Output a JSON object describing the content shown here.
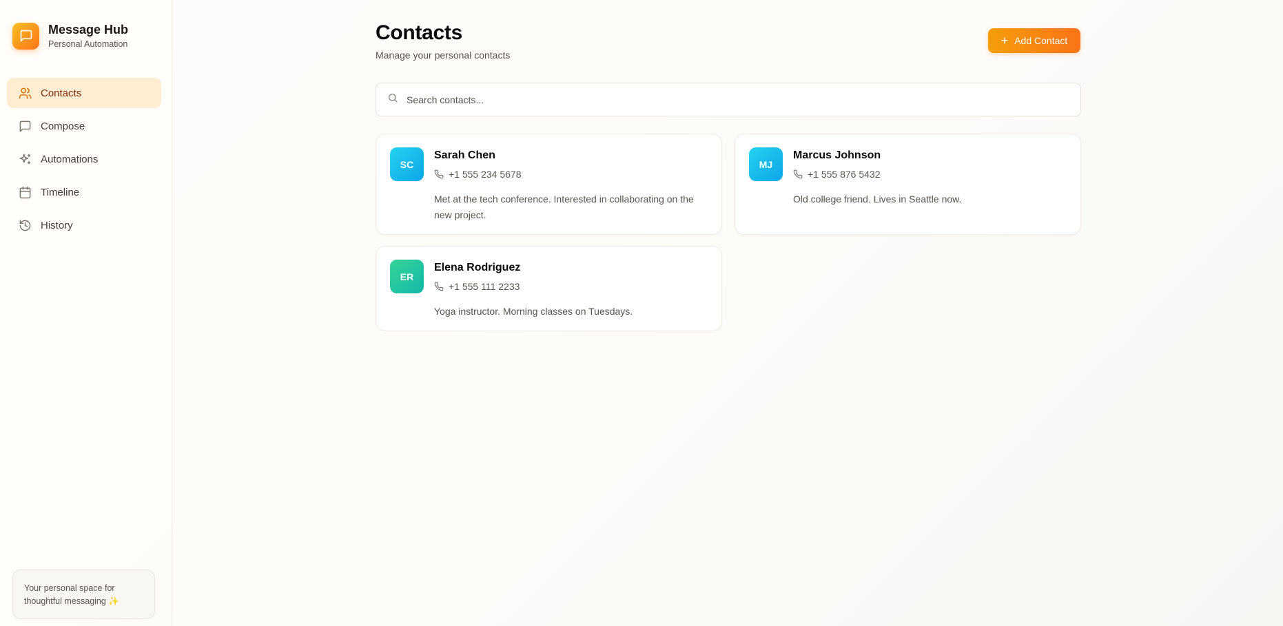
{
  "brand": {
    "title": "Message Hub",
    "subtitle": "Personal Automation",
    "icon": "message-square-icon",
    "gradient": [
      "#fbbf24",
      "#f97316"
    ]
  },
  "nav": {
    "items": [
      {
        "label": "Contacts",
        "icon": "users-icon",
        "active": true
      },
      {
        "label": "Compose",
        "icon": "message-square-icon",
        "active": false
      },
      {
        "label": "Automations",
        "icon": "sparkles-icon",
        "active": false
      },
      {
        "label": "Timeline",
        "icon": "calendar-icon",
        "active": false
      },
      {
        "label": "History",
        "icon": "history-icon",
        "active": false
      }
    ],
    "active_bg": "#feedd0",
    "accent": "#d97706"
  },
  "footer": {
    "line1": "Your personal space for",
    "line2": "thoughtful messaging ✨"
  },
  "header": {
    "title": "Contacts",
    "subtitle": "Manage your personal contacts",
    "add_button": "Add Contact"
  },
  "search": {
    "placeholder": "Search contacts...",
    "value": ""
  },
  "contacts": [
    {
      "initials": "SC",
      "name": "Sarah Chen",
      "phone": "+1 555 234 5678",
      "note": "Met at the tech conference. Interested in collaborating on the new project.",
      "avatar_colors": [
        "#22d3ee",
        "#0ea5e9"
      ]
    },
    {
      "initials": "MJ",
      "name": "Marcus Johnson",
      "phone": "+1 555 876 5432",
      "note": "Old college friend. Lives in Seattle now.",
      "avatar_colors": [
        "#22d3ee",
        "#0ea5e9"
      ]
    },
    {
      "initials": "ER",
      "name": "Elena Rodriguez",
      "phone": "+1 555 111 2233",
      "note": "Yoga instructor. Morning classes on Tuesdays.",
      "avatar_colors": [
        "#34d399",
        "#14b8a6"
      ]
    }
  ]
}
